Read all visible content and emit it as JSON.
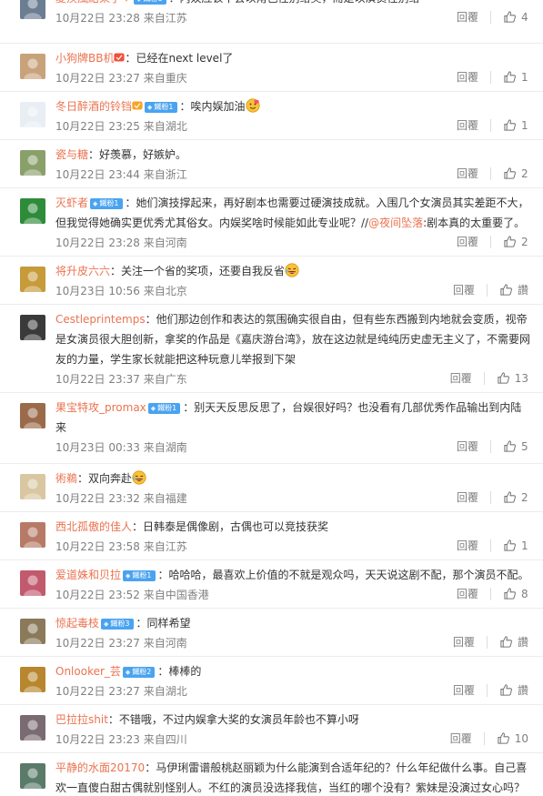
{
  "reply_label": "回覆",
  "colors": {
    "username": "#eb7350",
    "meta": "#808080",
    "badge": "#4aa3f0"
  },
  "comments": [
    {
      "name": "夏疾風結束了",
      "verified": true,
      "badge": "鐵粉1",
      "text": "：内娱应该不会以角色性别给奖，而是以演员性别给",
      "time": "10月22日 23:28 来自江苏",
      "likes": "4"
    },
    {
      "name": "小狗牌BB机",
      "icon": "badge-red",
      "text": "：已经在next level了",
      "time": "10月22日 23:27 来自重庆",
      "likes": "1"
    },
    {
      "name": "冬日醉酒的铃铛",
      "icon": "badge-gold",
      "badge": "鐵粉1",
      "text": "：唉内娱加油",
      "emoji": "heart-emoji",
      "time": "10月22日 23:25 来自湖北",
      "likes": "1"
    },
    {
      "name": "瓷与糖",
      "text": "：好羡慕，好嫉妒。",
      "time": "10月22日 23:44 来自浙江",
      "likes": "2"
    },
    {
      "name": "灭虾者",
      "badge": "鐵粉1",
      "text": "：她们演技撑起来，再好剧本也需要过硬演技成就。入围几个女演员其实差距不大，但我觉得她确实更优秀尤其俗女。内娱奖啥时候能如此专业呢？//",
      "mention": "@夜间坠落",
      "text2": ":剧本真的太重要了。",
      "time": "10月22日 23:28 来自河南",
      "likes": "2"
    },
    {
      "name": "将升皮六六",
      "text": "：关注一个省的奖项，还要自我反省",
      "emoji": "laugh-emoji",
      "time": "10月23日 10:56 来自北京",
      "likes": "讚"
    },
    {
      "name": "Cestleprintemps",
      "text": "：他们那边创作和表达的氛围确实很自由，但有些东西搬到内地就会变质，视帝是女演员很大胆创新，拿奖的作品是《嘉庆游台湾》，放在这边就是纯纯历史虚无主义了，不需要网友的力量，学生家长就能把这种玩意儿举报到下架",
      "time": "10月22日 23:37 来自广东",
      "likes": "13"
    },
    {
      "name": "果宝特攻_promax",
      "badge": "鐵粉1",
      "text": "：别天天反思反思了，台娱很好吗？也没看有几部优秀作品输出到内陆来",
      "time": "10月23日 00:33 来自湖南",
      "likes": "5"
    },
    {
      "name": "術鵜",
      "text": "：双向奔赴",
      "emoji": "laugh-emoji",
      "time": "10月22日 23:32 来自福建",
      "likes": "2"
    },
    {
      "name": "西北孤傲的佳人",
      "text": "：日韩泰是偶像剧，古偶也可以竞技获奖",
      "time": "10月22日 23:58 来自江苏",
      "likes": "1"
    },
    {
      "name": "爱道姝和贝拉",
      "badge": "鐵粉1",
      "text": "：哈哈哈，最喜欢上价值的不就是观众吗，天天说这剧不配，那个演员不配。",
      "time": "10月22日 23:52 来自中国香港",
      "likes": "8"
    },
    {
      "name": "惊起毒枝",
      "badge": "鐵粉3",
      "text": "：同样希望",
      "time": "10月22日 23:27 来自河南",
      "likes": "讚"
    },
    {
      "name": "Onlooker_芸",
      "badge": "鐵粉2",
      "text": "：棒棒的",
      "time": "10月22日 23:27 来自湖北",
      "likes": "讚"
    },
    {
      "name": "巴拉拉shit",
      "text": "：不错哦，不过内娱拿大奖的女演员年龄也不算小呀",
      "time": "10月22日 23:23 来自四川",
      "likes": "10"
    },
    {
      "name": "平静的水面20170",
      "text": "：马伊琍雷谱般桃赵丽颖为什么能演到合适年纪的？什么年纪做什么事。自己喜欢一直傻白甜古偶就别怪别人。不红的演员没选择我信，当红的哪个没有？紫妹是没演过女心吗？",
      "time": "",
      "likes": ""
    }
  ]
}
